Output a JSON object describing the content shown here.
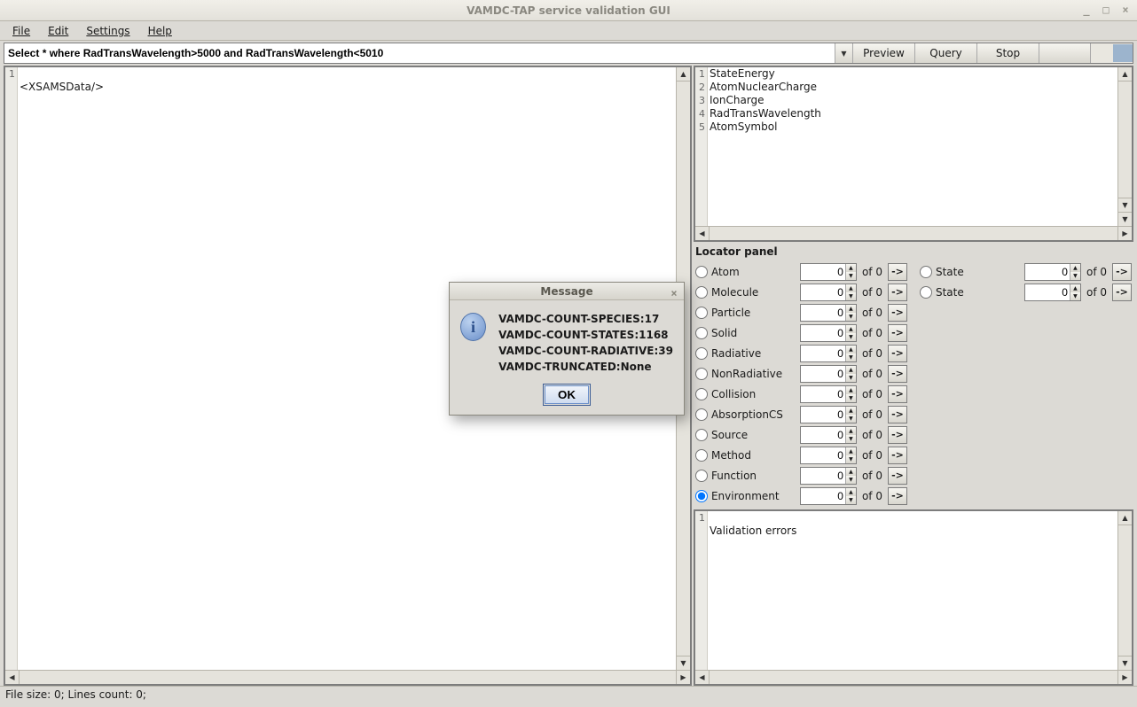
{
  "window": {
    "title": "VAMDC-TAP service validation GUI",
    "controls": {
      "min": "_",
      "max": "□",
      "close": "×"
    }
  },
  "menu": {
    "file": "File",
    "edit": "Edit",
    "settings": "Settings",
    "help": "Help"
  },
  "query": {
    "text": "Select * where RadTransWavelength>5000 and RadTransWavelength<5010",
    "preview": "Preview",
    "query_btn": "Query",
    "stop": "Stop"
  },
  "xml_editor": {
    "line1_num": "1",
    "line1_text": "<XSAMSData/>"
  },
  "keyword_list": {
    "items": [
      {
        "n": "1",
        "v": "StateEnergy"
      },
      {
        "n": "2",
        "v": "AtomNuclearCharge"
      },
      {
        "n": "3",
        "v": "IonCharge"
      },
      {
        "n": "4",
        "v": "RadTransWavelength"
      },
      {
        "n": "5",
        "v": "AtomSymbol"
      }
    ]
  },
  "locator": {
    "title": "Locator panel",
    "of_label": "of 0",
    "go_label": "->",
    "rows_left": [
      "Atom",
      "Molecule",
      "Particle",
      "Solid",
      "Radiative",
      "NonRadiative",
      "Collision",
      "AbsorptionCS",
      "Source",
      "Method",
      "Function",
      "Environment"
    ],
    "rows_right": [
      "State",
      "State"
    ],
    "selected": "Environment",
    "value": "0"
  },
  "validation": {
    "line1_num": "1",
    "line1_text": "Validation errors"
  },
  "statusbar": "File size: 0; Lines count: 0;",
  "dialog": {
    "title": "Message",
    "close": "×",
    "icon_letter": "i",
    "lines": [
      "VAMDC-COUNT-SPECIES:17",
      "VAMDC-COUNT-STATES:1168",
      "VAMDC-COUNT-RADIATIVE:39",
      "VAMDC-TRUNCATED:None"
    ],
    "ok": "OK"
  }
}
